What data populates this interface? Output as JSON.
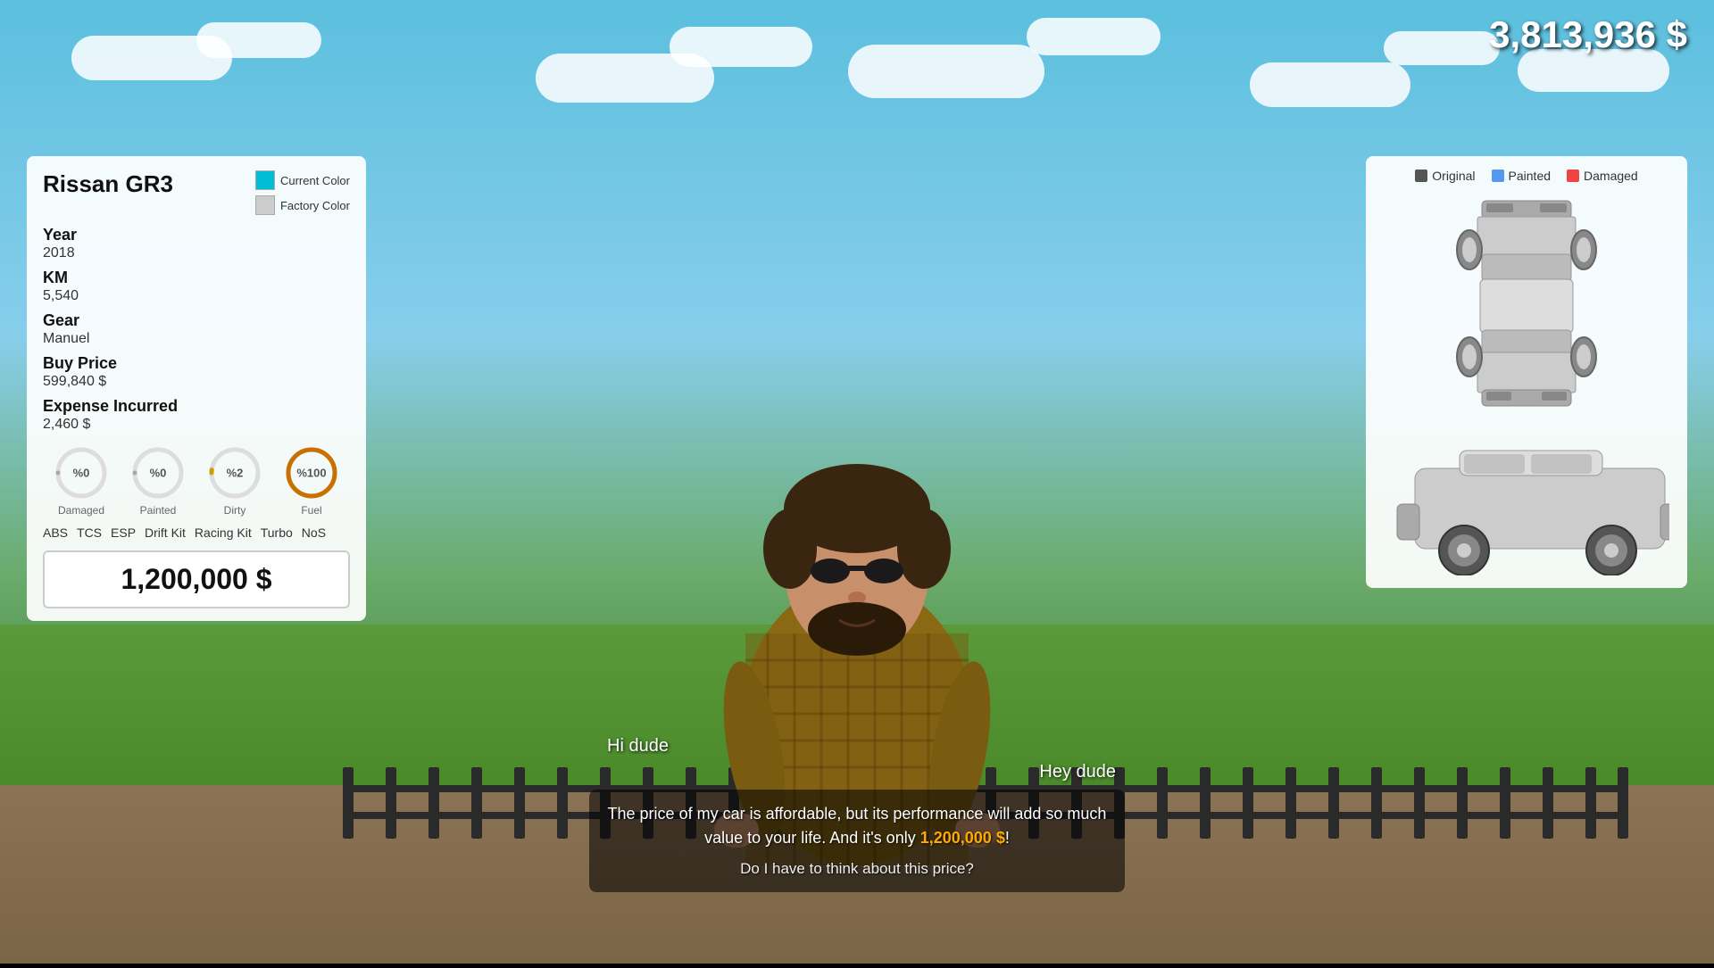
{
  "hud": {
    "money": "3,813,936 $"
  },
  "car_panel": {
    "title": "Rissan GR3",
    "current_color_label": "Current Color",
    "factory_color_label": "Factory Color",
    "current_color_hex": "#00bcd4",
    "factory_color_hex": "#cccccc",
    "year_label": "Year",
    "year_value": "2018",
    "km_label": "KM",
    "km_value": "5,540",
    "gear_label": "Gear",
    "gear_value": "Manuel",
    "buy_price_label": "Buy Price",
    "buy_price_value": "599,840 $",
    "expense_label": "Expense Incurred",
    "expense_value": "2,460 $",
    "gauges": [
      {
        "id": "damaged",
        "label": "Damaged",
        "value": "0",
        "display": "%0",
        "color": "#aaa",
        "percent": 0
      },
      {
        "id": "painted",
        "label": "Painted",
        "value": "0",
        "display": "%0",
        "color": "#aaa",
        "percent": 0
      },
      {
        "id": "dirty",
        "label": "Dirty",
        "value": "2",
        "display": "%2",
        "color": "#c8a000",
        "percent": 2
      },
      {
        "id": "fuel",
        "label": "Fuel",
        "value": "100",
        "display": "%100",
        "color": "#c87000",
        "percent": 100
      }
    ],
    "features": [
      "ABS",
      "TCS",
      "ESP",
      "Drift Kit",
      "Racing Kit",
      "Turbo",
      "NoS"
    ],
    "sell_price": "1,200,000 $"
  },
  "diagram_panel": {
    "legend": [
      {
        "label": "Original",
        "color": "#555555"
      },
      {
        "label": "Painted",
        "color": "#5599ee"
      },
      {
        "label": "Damaged",
        "color": "#ee4444"
      }
    ]
  },
  "dialogue": {
    "player_say": "Hi dude",
    "npc_say": "Hey dude",
    "main_text": "The price of my car is affordable, but its performance will add so much value to your life. And it's only",
    "price_highlight": "1,200,000 $",
    "price_suffix": "!",
    "question": "Do I have to think about this price?"
  }
}
